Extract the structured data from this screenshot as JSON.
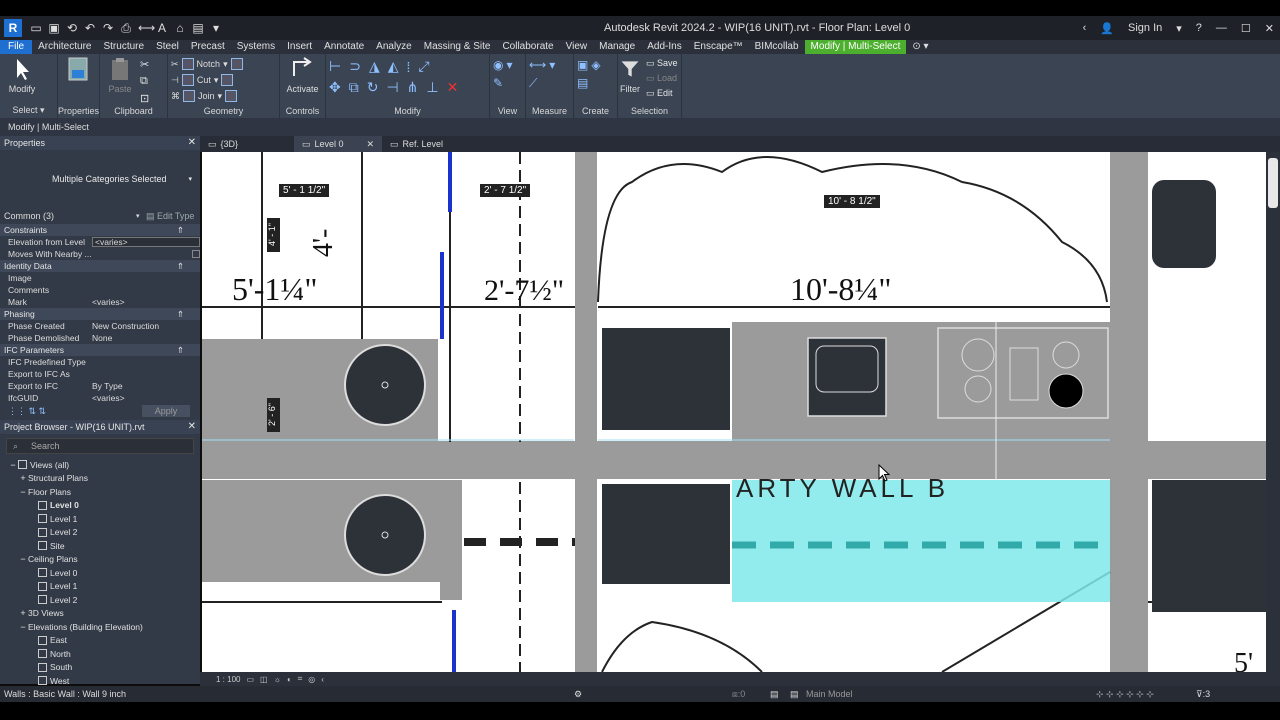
{
  "app": {
    "logo": "R",
    "title": "Autodesk Revit 2024.2 - WIP(16 UNIT).rvt - Floor Plan: Level 0",
    "sign_in": "Sign In"
  },
  "menu": [
    "File",
    "Architecture",
    "Structure",
    "Steel",
    "Precast",
    "Systems",
    "Insert",
    "Annotate",
    "Analyze",
    "Massing & Site",
    "Collaborate",
    "View",
    "Manage",
    "Add-Ins",
    "Enscape™",
    "BIMcollab",
    "Modify | Multi-Select"
  ],
  "ribbon": {
    "select": {
      "modify": "Modify",
      "label": "Select"
    },
    "properties": {
      "label": "Properties"
    },
    "clipboard": {
      "paste": "Paste",
      "label": "Clipboard"
    },
    "geometry": {
      "notch": "Notch",
      "cut": "Cut",
      "join": "Join",
      "label": "Geometry"
    },
    "controls": {
      "activate": "Activate",
      "label": "Controls"
    },
    "modify": {
      "label": "Modify"
    },
    "view": {
      "label": "View"
    },
    "measure": {
      "label": "Measure"
    },
    "create": {
      "label": "Create"
    },
    "selection": {
      "filter": "Filter",
      "save": "Save",
      "load": "Load",
      "edit": "Edit",
      "label": "Selection"
    }
  },
  "option_bar": "Modify | Multi-Select",
  "properties": {
    "header": "Properties",
    "type": "Multiple Categories Selected",
    "filter": "Common (3)",
    "edit_type": "Edit Type",
    "sections": [
      {
        "name": "Constraints",
        "rows": [
          [
            "Elevation from Level",
            "<varies>"
          ],
          [
            "Moves With Nearby ...",
            ""
          ]
        ]
      },
      {
        "name": "Identity Data",
        "rows": [
          [
            "Image",
            ""
          ],
          [
            "Comments",
            ""
          ],
          [
            "Mark",
            "<varies>"
          ]
        ]
      },
      {
        "name": "Phasing",
        "rows": [
          [
            "Phase Created",
            "New Construction"
          ],
          [
            "Phase Demolished",
            "None"
          ]
        ]
      },
      {
        "name": "IFC Parameters",
        "rows": [
          [
            "IFC Predefined Type",
            ""
          ],
          [
            "Export to IFC As",
            ""
          ],
          [
            "Export to IFC",
            "By Type"
          ],
          [
            "IfcGUID",
            "<varies>"
          ]
        ]
      }
    ],
    "apply": "Apply"
  },
  "browser": {
    "header": "Project Browser - WIP(16 UNIT).rvt",
    "search": "Search",
    "items": [
      {
        "label": "Views (all)",
        "level": 0,
        "tog": "−"
      },
      {
        "label": "Structural Plans",
        "level": 1,
        "tog": "+"
      },
      {
        "label": "Floor Plans",
        "level": 1,
        "tog": "−"
      },
      {
        "label": "Level 0",
        "level": 2,
        "tog": "",
        "bold": true
      },
      {
        "label": "Level 1",
        "level": 2,
        "tog": ""
      },
      {
        "label": "Level 2",
        "level": 2,
        "tog": ""
      },
      {
        "label": "Site",
        "level": 2,
        "tog": ""
      },
      {
        "label": "Ceiling Plans",
        "level": 1,
        "tog": "−"
      },
      {
        "label": "Level 0",
        "level": 2,
        "tog": ""
      },
      {
        "label": "Level 1",
        "level": 2,
        "tog": ""
      },
      {
        "label": "Level 2",
        "level": 2,
        "tog": ""
      },
      {
        "label": "3D Views",
        "level": 1,
        "tog": "+"
      },
      {
        "label": "Elevations (Building Elevation)",
        "level": 1,
        "tog": "−"
      },
      {
        "label": "East",
        "level": 2,
        "tog": ""
      },
      {
        "label": "North",
        "level": 2,
        "tog": ""
      },
      {
        "label": "South",
        "level": 2,
        "tog": ""
      },
      {
        "label": "West",
        "level": 2,
        "tog": ""
      }
    ]
  },
  "tabs": [
    {
      "label": "{3D}",
      "close": ""
    },
    {
      "label": "Level 0",
      "close": "✕"
    },
    {
      "label": "Ref. Level",
      "close": ""
    }
  ],
  "canvas": {
    "dims": [
      "5' - 1 1/2\"",
      "2' - 7 1/2\"",
      "10' - 8 1/2\"",
      "4' - 1\"",
      "2' - 6\""
    ],
    "drawing_text": [
      "5'-1¼\"",
      "2'-7½\"",
      "10'-8¼\"",
      "4'-",
      "ARTY WALL B",
      "5'"
    ]
  },
  "view_control": {
    "scale": "1 : 100"
  },
  "status": {
    "left": "Walls : Basic Wall : Wall 9 inch",
    "zero": ":0",
    "model": "Main Model",
    "filter_count": ":3"
  }
}
